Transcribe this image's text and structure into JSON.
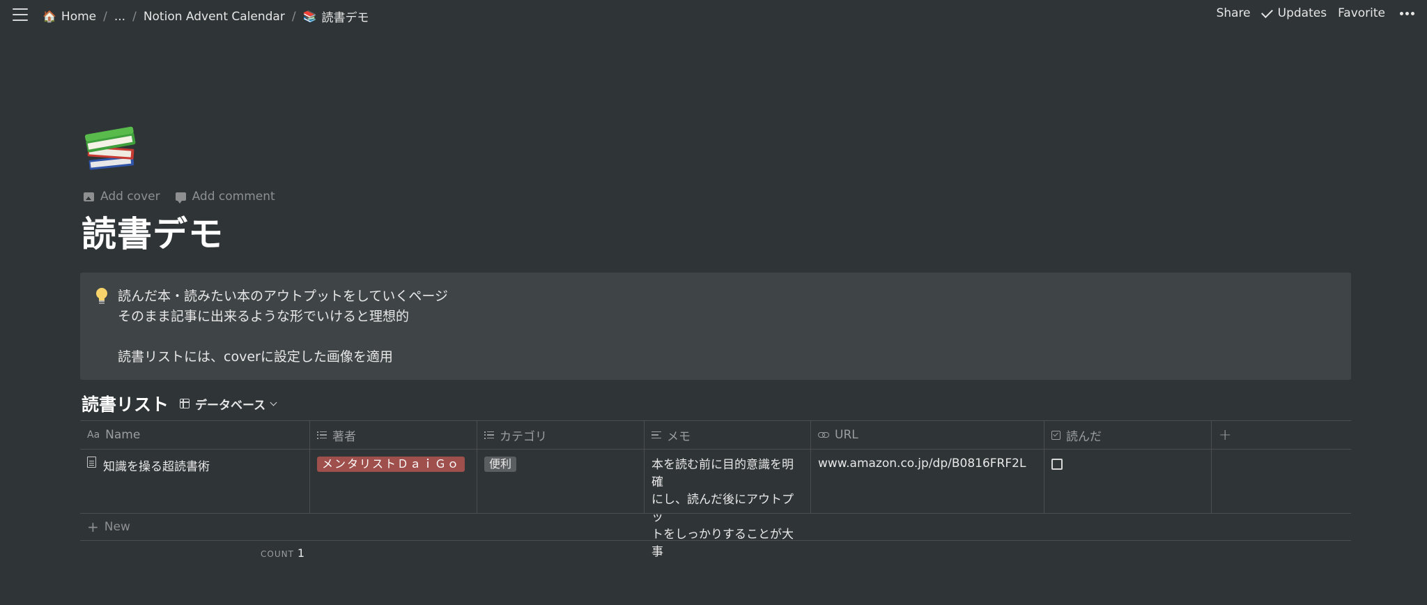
{
  "topbar": {
    "breadcrumbs": [
      {
        "icon": "house-icon",
        "emoji": "🏠",
        "label": "Home"
      },
      {
        "label": "..."
      },
      {
        "label": "Notion Advent Calendar"
      },
      {
        "icon": "books-icon",
        "emoji": "📚",
        "label": "読書デモ"
      }
    ],
    "separator": "/",
    "share_label": "Share",
    "updates_label": "Updates",
    "favorite_label": "Favorite"
  },
  "page": {
    "icon": "books-icon",
    "add_cover_label": "Add cover",
    "add_comment_label": "Add comment",
    "title": "読書デモ"
  },
  "callout": {
    "icon": "lightbulb-icon",
    "lines": [
      "読んだ本・読みたい本のアウトプットをしていくページ",
      "そのまま記事に出来るような形でいけると理想的",
      "",
      "読書リストには、coverに設定した画像を適用"
    ]
  },
  "database": {
    "title": "読書リスト",
    "view_label": "データベース",
    "columns": [
      {
        "label": "Name",
        "icon": "text-aa-icon"
      },
      {
        "label": "著者",
        "icon": "list-icon"
      },
      {
        "label": "カテゴリ",
        "icon": "list-icon"
      },
      {
        "label": "メモ",
        "icon": "text-lines-icon"
      },
      {
        "label": "URL",
        "icon": "link-icon"
      },
      {
        "label": "読んだ",
        "icon": "checkbox-icon"
      }
    ],
    "rows": [
      {
        "name": "知識を操る超読書術",
        "author": "メンタリストＤａｉＧｏ",
        "category": "便利",
        "memo": [
          "本を読む前に目的意識を明確",
          "にし、読んだ後にアウトプッ",
          "トをしっかりすることが大事"
        ],
        "url": "www.amazon.co.jp/dp/B0816FRF2L",
        "read": false
      }
    ],
    "new_label": "New",
    "count_label": "COUNT",
    "count_value": "1",
    "colors": {
      "author_tag": "#a0504c",
      "category_tag": "#5a5e61"
    }
  }
}
